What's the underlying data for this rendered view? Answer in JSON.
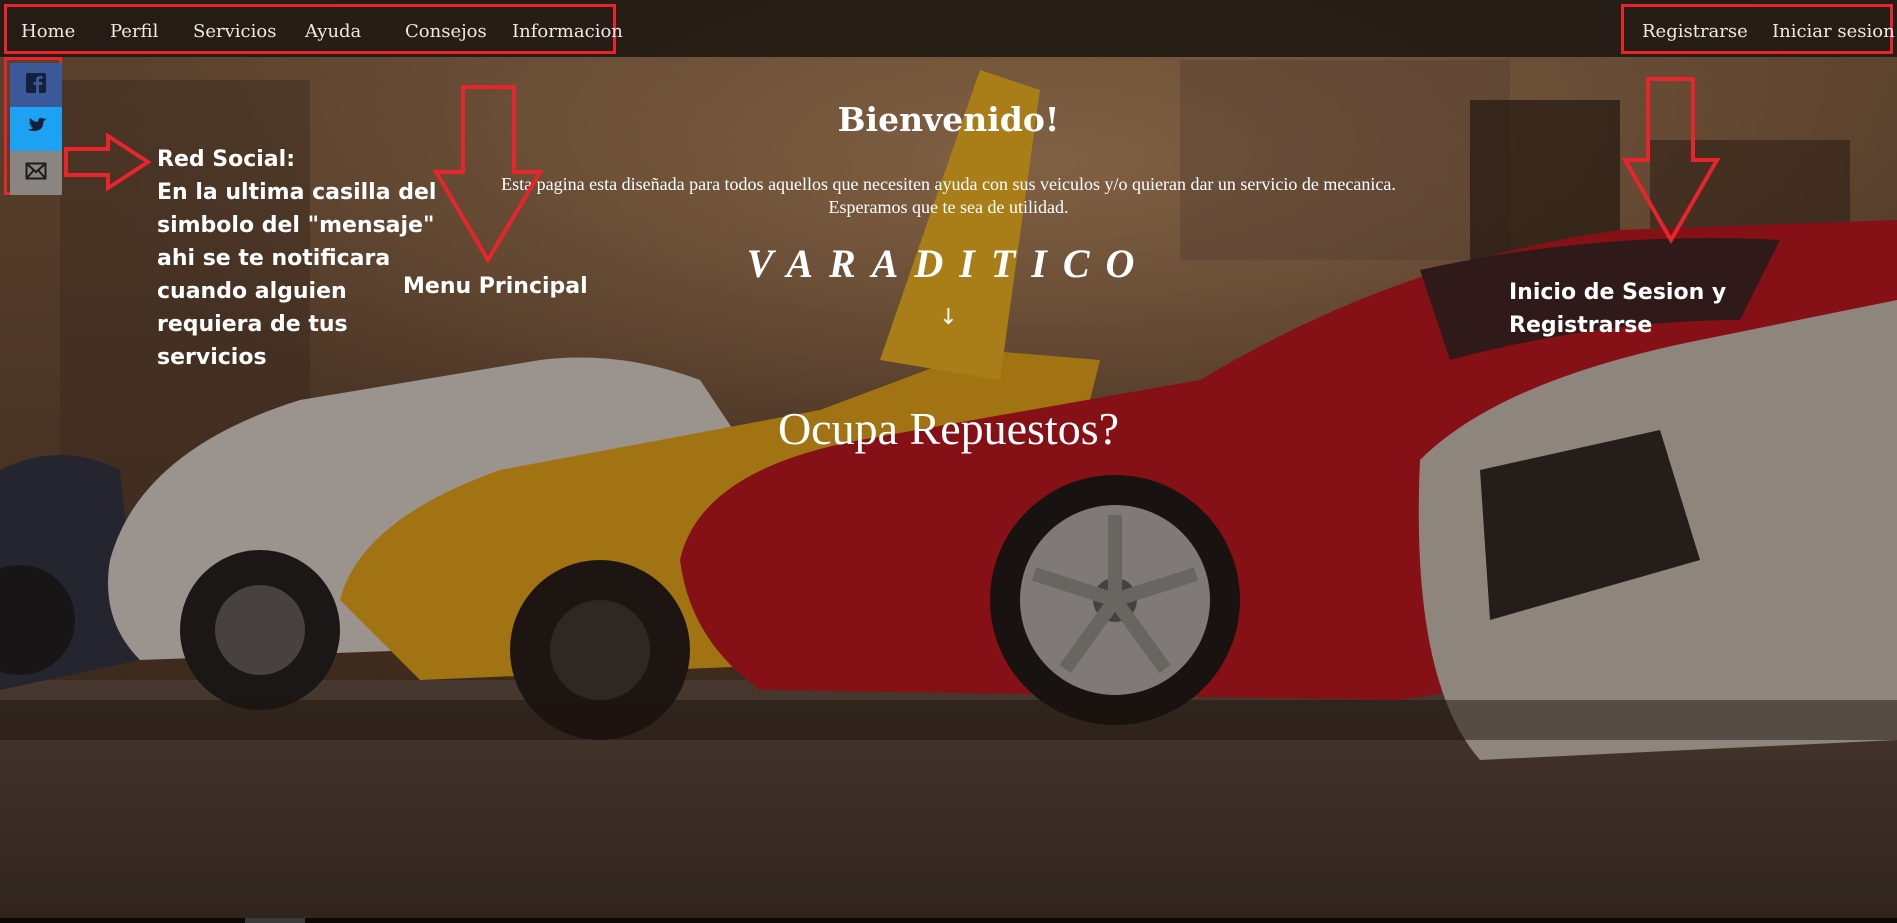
{
  "nav": {
    "left_items": [
      "Home",
      "Perfil",
      "Servicios",
      "Ayuda",
      "Consejos",
      "Informacion"
    ],
    "right_items": [
      "Registrarse",
      "Iniciar sesion"
    ]
  },
  "social": [
    {
      "icon": "facebook-icon",
      "color": "#3b5998"
    },
    {
      "icon": "twitter-icon",
      "color": "#1da1f2"
    },
    {
      "icon": "mail-icon",
      "color": "#8a8580"
    }
  ],
  "hero": {
    "title": "Bienvenido!",
    "desc_line1": "Esta pagina esta diseñada para todos aquellos que necesiten ayuda con sus veiculos y/o quieran dar un servicio de mecanica.",
    "desc_line2": "Esperamos que te sea de utilidad.",
    "brand": "VARADITICO",
    "arrow": "↓",
    "question": "Ocupa Repuestos?"
  },
  "annotations": {
    "social_title": "Red Social:",
    "social_body": "En la ultima casilla del simbolo del \"mensaje\" ahi se te notificara cuando alguien requiera de tus servicios",
    "menu": "Menu Principal",
    "login": "Inicio de Sesion  y Registrarse"
  },
  "colors": {
    "annotation_red": "#e8242c",
    "navbar_bg": "#211a14",
    "car_red": "#b8121c",
    "car_yellow": "#e0a51a",
    "car_white": "#d8d4cc"
  }
}
